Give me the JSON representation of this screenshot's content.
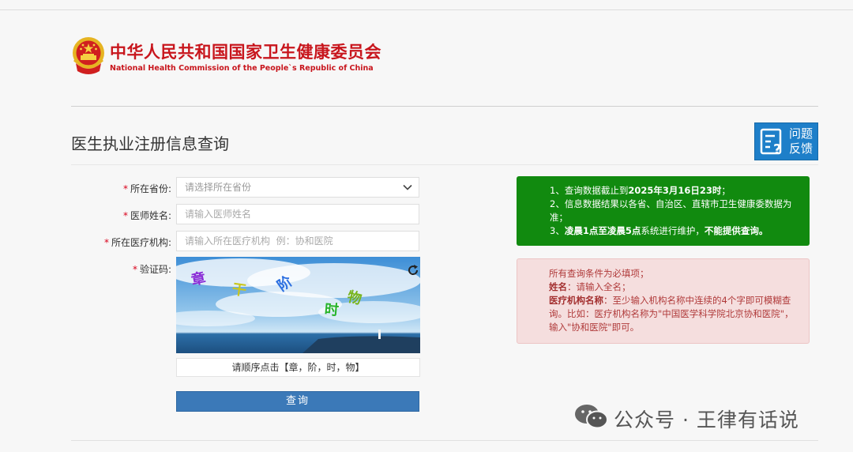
{
  "header": {
    "org_name_cn": "中华人民共和国国家卫生健康委员会",
    "org_name_en": "National Health Commission of the People`s Republic of China"
  },
  "page": {
    "title": "医生执业注册信息查询",
    "feedback_line1": "问题",
    "feedback_line2": "反馈"
  },
  "form": {
    "province": {
      "required_mark": "*",
      "label": "所在省份:",
      "placeholder": "请选择所在省份"
    },
    "name": {
      "required_mark": "*",
      "label": "医师姓名:",
      "placeholder": "请输入医师姓名"
    },
    "institution": {
      "required_mark": "*",
      "label": "所在医疗机构:",
      "placeholder": "请输入所在医疗机构  例：协和医院"
    },
    "captcha": {
      "required_mark": "*",
      "label": "验证码:",
      "chars": [
        "章",
        "干",
        "阶",
        "时",
        "物"
      ],
      "hint": "请顺序点击【章，阶，时，物】"
    },
    "submit_label": "查询"
  },
  "notice_green": {
    "l1_a": "1、查询数据截止到",
    "l1_b": "2025年3月16日23时",
    "l1_c": "；",
    "l2": "2、信息数据结果以各省、自治区、直辖市卫生健康委数据为准；",
    "l3_a": "3、",
    "l3_b": "凌晨1点至凌晨5点",
    "l3_c": "系统进行维护，",
    "l3_d": "不能提供查询。"
  },
  "notice_pink": {
    "l1": "所有查询条件为必填项；",
    "l2_label": "姓名",
    "l2_text": "：请输入全名；",
    "l3_label": "医疗机构名称",
    "l3_text": "：至少输入机构名称中连续的4个字即可模糊查询。比如：医疗机构名称为\"中国医学科学院北京协和医院\"，输入\"协和医院\"即可。"
  },
  "watermark": {
    "text": "公众号 · 王律有话说"
  },
  "colors": {
    "brand_red": "#c8161d",
    "notice_green": "#118a0f",
    "notice_pink_bg": "#f5dede",
    "submit_blue": "#3b79b8",
    "feedback_blue": "#1e7fc9"
  }
}
